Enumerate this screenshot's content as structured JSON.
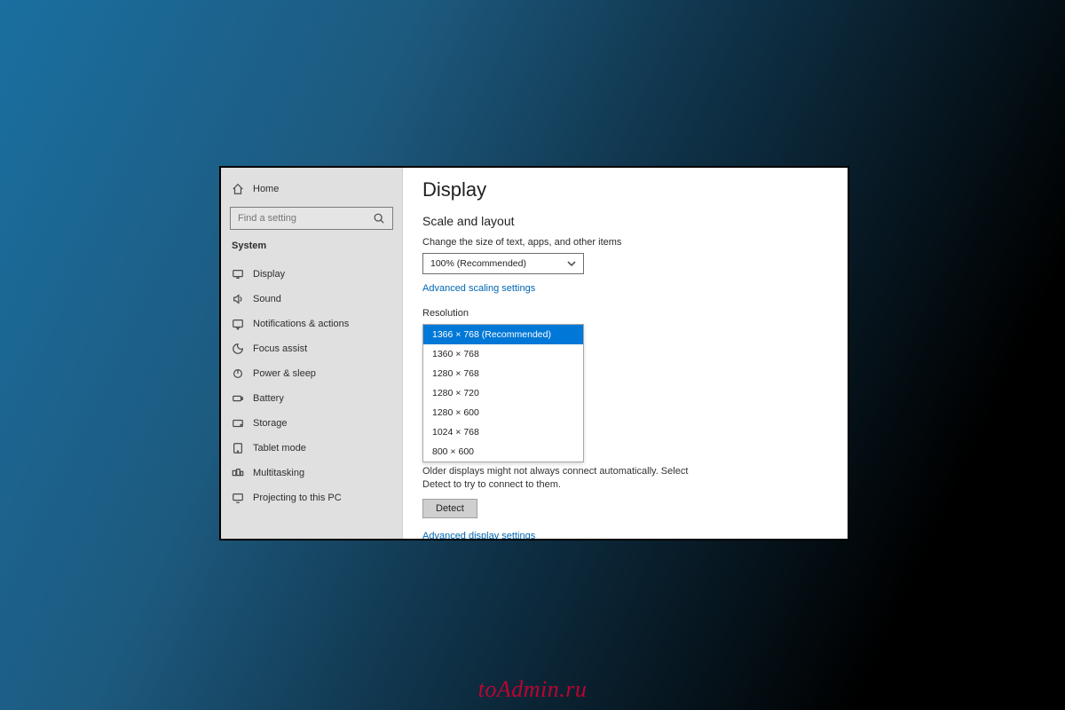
{
  "sidebar": {
    "home_label": "Home",
    "search_placeholder": "Find a setting",
    "category_label": "System",
    "items": [
      {
        "icon": "display",
        "label": "Display"
      },
      {
        "icon": "sound",
        "label": "Sound"
      },
      {
        "icon": "notif",
        "label": "Notifications & actions"
      },
      {
        "icon": "focus",
        "label": "Focus assist"
      },
      {
        "icon": "power",
        "label": "Power & sleep"
      },
      {
        "icon": "battery",
        "label": "Battery"
      },
      {
        "icon": "storage",
        "label": "Storage"
      },
      {
        "icon": "tablet",
        "label": "Tablet mode"
      },
      {
        "icon": "multi",
        "label": "Multitasking"
      },
      {
        "icon": "project",
        "label": "Projecting to this PC"
      }
    ]
  },
  "main": {
    "title": "Display",
    "section_heading": "Scale and layout",
    "scale_label": "Change the size of text, apps, and other items",
    "scale_value": "100% (Recommended)",
    "advanced_scaling_link": "Advanced scaling settings",
    "resolution_label": "Resolution",
    "resolution_options": [
      "1366 × 768 (Recommended)",
      "1360 × 768",
      "1280 × 768",
      "1280 × 720",
      "1280 × 600",
      "1024 × 768",
      "800 × 600"
    ],
    "resolution_selected_index": 0,
    "detect_hint": "Older displays might not always connect automatically. Select Detect to try to connect to them.",
    "detect_button": "Detect",
    "advanced_display_link": "Advanced display settings"
  },
  "watermark": "toAdmin.ru"
}
